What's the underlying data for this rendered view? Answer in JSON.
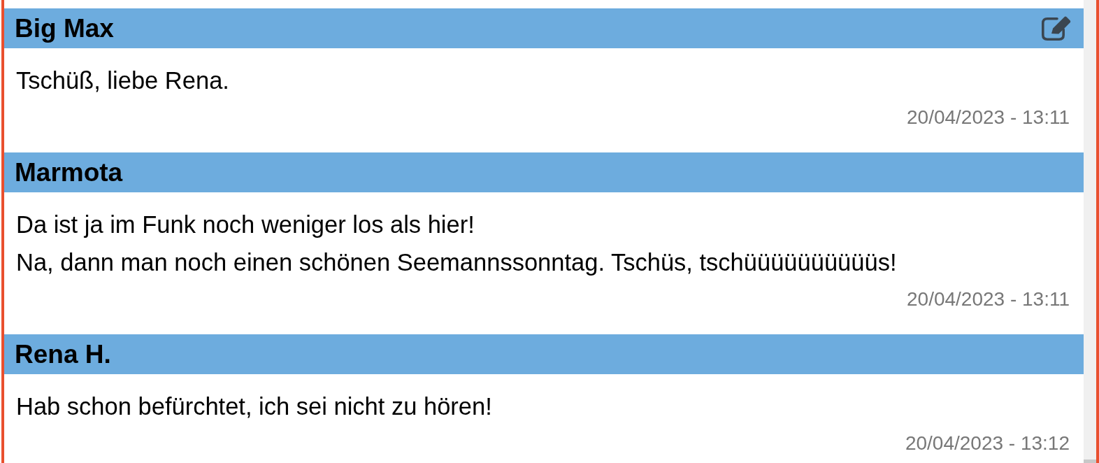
{
  "messages": [
    {
      "author": "Big Max",
      "editable": true,
      "lines": [
        "Tschüß, liebe Rena."
      ],
      "timestamp": "20/04/2023 - 13:11"
    },
    {
      "author": "Marmota",
      "editable": false,
      "lines": [
        "Da ist ja im Funk noch weniger los als hier!",
        "Na, dann man noch einen schönen Seemannssonntag. Tschüs, tschüüüüüüüüüüs!"
      ],
      "timestamp": "20/04/2023 - 13:11"
    },
    {
      "author": "Rena H.",
      "editable": false,
      "lines": [
        "Hab schon befürchtet, ich sei nicht zu hören!"
      ],
      "timestamp": "20/04/2023 - 13:12"
    }
  ]
}
